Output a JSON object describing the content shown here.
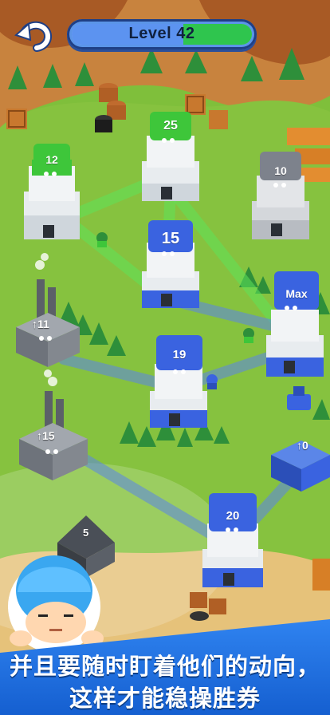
{
  "header": {
    "back_icon": "undo-arrow-icon",
    "level_label": "Level 42",
    "level_progress": 0.38
  },
  "towers": [
    {
      "team": "green",
      "label": "12"
    },
    {
      "team": "green",
      "label": "25"
    },
    {
      "team": "gray",
      "label": "10"
    },
    {
      "team": "blue",
      "label": "15"
    },
    {
      "team": "blue",
      "label": "Max"
    },
    {
      "team": "blue",
      "label": "19"
    },
    {
      "team": "blue",
      "label": "20"
    }
  ],
  "factories": [
    {
      "team": "gray",
      "label": "↑11"
    },
    {
      "team": "gray",
      "label": "↑15"
    },
    {
      "team": "blue",
      "label": "↑0"
    },
    {
      "team": "gray",
      "label": "5"
    }
  ],
  "caption": {
    "line1": "并且要随时盯着他们的动向，",
    "line2": "这样才能稳操胜券"
  },
  "colors": {
    "grass": "#7fbf3b",
    "blue_team": "#3a63e0",
    "green_team": "#3ec63a",
    "gray_team": "#8a8f99",
    "caption_bg": "#1f6fe0"
  }
}
